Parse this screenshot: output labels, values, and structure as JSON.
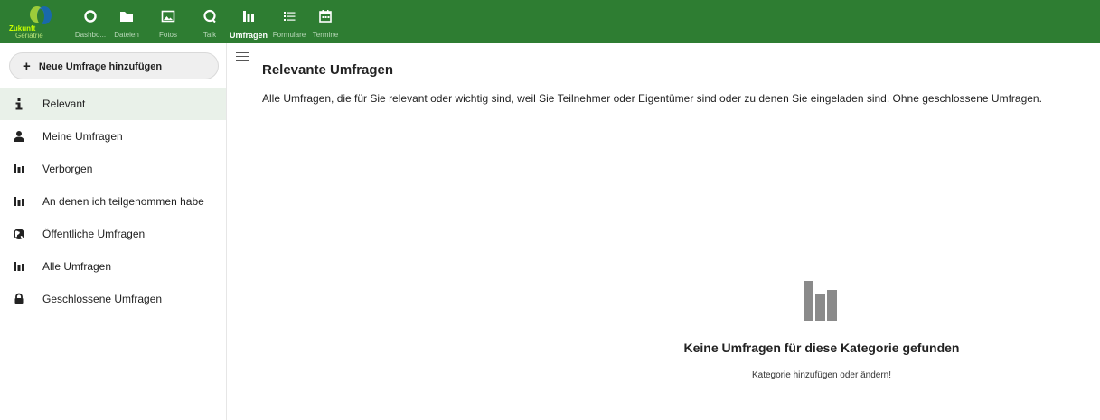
{
  "header": {
    "logo": {
      "line1": "Zukunft",
      "line2": "Geriatrie"
    },
    "apps": [
      {
        "label": "Dashbo...",
        "icon": "dashboard-circle-icon"
      },
      {
        "label": "Dateien",
        "icon": "folder-icon"
      },
      {
        "label": "Fotos",
        "icon": "image-icon"
      },
      {
        "label": "Talk",
        "icon": "talk-bubble-icon"
      },
      {
        "label": "Umfragen",
        "icon": "poll-bars-icon",
        "active": true
      },
      {
        "label": "Formulare",
        "icon": "list-icon"
      },
      {
        "label": "Termine",
        "icon": "calendar-icon"
      }
    ]
  },
  "sidebar": {
    "new_button": {
      "plus": "+",
      "label": "Neue Umfrage hinzufügen"
    },
    "items": [
      {
        "label": "Relevant",
        "icon": "info-icon",
        "active": true
      },
      {
        "label": "Meine Umfragen",
        "icon": "user-icon"
      },
      {
        "label": "Verborgen",
        "icon": "poll-bars-icon"
      },
      {
        "label": "An denen ich teilgenommen habe",
        "icon": "poll-bars-icon"
      },
      {
        "label": "Öffentliche Umfragen",
        "icon": "globe-icon"
      },
      {
        "label": "Alle Umfragen",
        "icon": "poll-bars-icon"
      },
      {
        "label": "Geschlossene Umfragen",
        "icon": "lock-icon"
      }
    ]
  },
  "main": {
    "title": "Relevante Umfragen",
    "description": "Alle Umfragen, die für Sie relevant oder wichtig sind, weil Sie Teilnehmer oder Eigentümer sind oder zu denen Sie eingeladen sind. Ohne geschlossene Umfragen.",
    "empty": {
      "icon": "poll-bars-icon",
      "title": "Keine Umfragen für diese Kategorie gefunden",
      "subtitle": "Kategorie hinzufügen oder ändern!"
    }
  },
  "colors": {
    "header": "#2e7d32",
    "active_item": "#e9f1e9",
    "logo_accent": "#c6ff00"
  }
}
